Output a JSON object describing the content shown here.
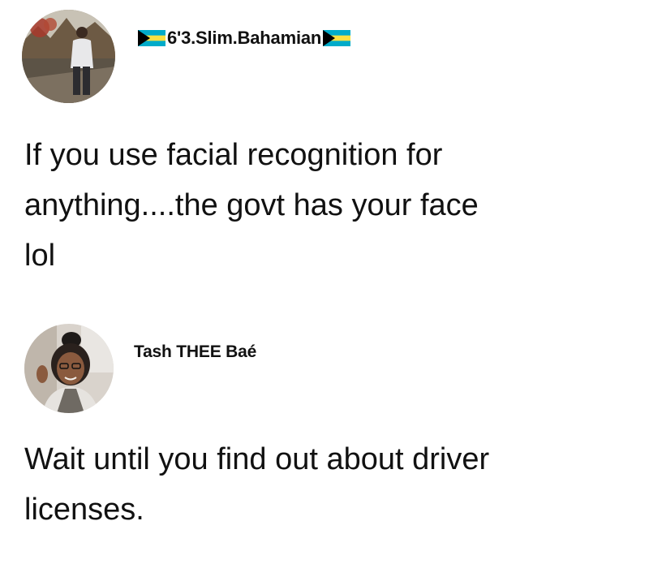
{
  "post_1": {
    "author": "6'3.Slim.Bahamian",
    "author_flags": [
      "bahamas-flag-icon",
      "bahamas-flag-icon"
    ],
    "text": "If you use facial recognition for\nanything....the govt has your face\nlol"
  },
  "post_2": {
    "author": "Tash THEE Baé",
    "text": "Wait until you find out about driver\nlicenses."
  },
  "colors": {
    "background": "#ffffff",
    "text": "#111111",
    "flag_aquamarine": "#00abc9",
    "flag_gold": "#fae042",
    "flag_black": "#000000"
  }
}
